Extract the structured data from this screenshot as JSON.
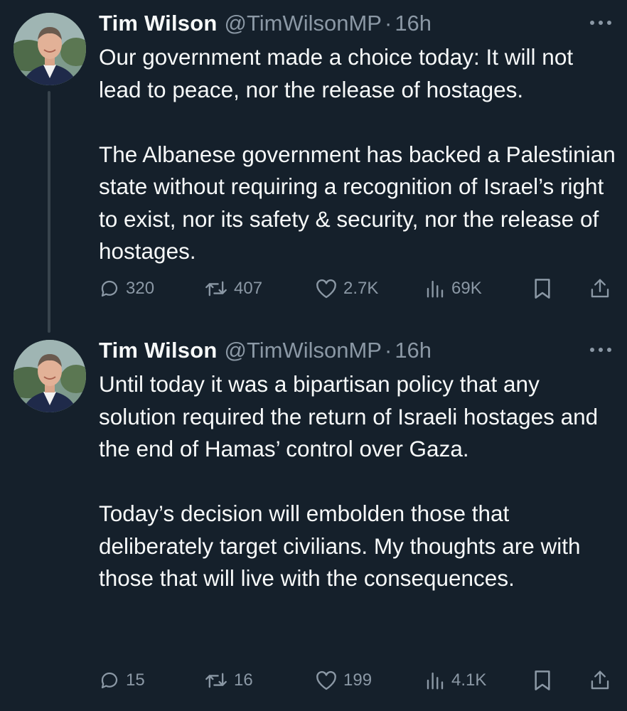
{
  "tweets": [
    {
      "name": "Tim Wilson",
      "handle": "@TimWilsonMP",
      "separator": "·",
      "time": "16h",
      "paragraphs": [
        "Our government made a choice today: It will not lead to peace, nor the release of hostages.",
        "The Albanese government has backed a Palestinian state without requiring a recognition of Israel’s right to exist, nor its safety & security, nor the release of hostages."
      ],
      "stats": {
        "replies": "320",
        "reposts": "407",
        "likes": "2.7K",
        "views": "69K"
      }
    },
    {
      "name": "Tim Wilson",
      "handle": "@TimWilsonMP",
      "separator": "·",
      "time": "16h",
      "paragraphs": [
        "Until today it was a bipartisan policy that any solution required the return of Israeli hostages and the end of Hamas’ control over Gaza.",
        "Today’s decision will embolden those that deliberately target civilians. My thoughts are with those that will live with the consequences."
      ],
      "stats": {
        "replies": "15",
        "reposts": "16",
        "likes": "199",
        "views": "4.1K"
      }
    }
  ],
  "icons": {
    "reply": "speech-bubble-icon",
    "repost": "repost-arrows-icon",
    "like": "heart-icon",
    "views": "bar-chart-icon",
    "bookmark": "bookmark-icon",
    "share": "share-upload-icon",
    "more": "more-dots-icon"
  },
  "colors": {
    "background": "#15202b",
    "text": "#f7f9f9",
    "secondary": "#8b98a5",
    "thread_line": "#38444d"
  }
}
